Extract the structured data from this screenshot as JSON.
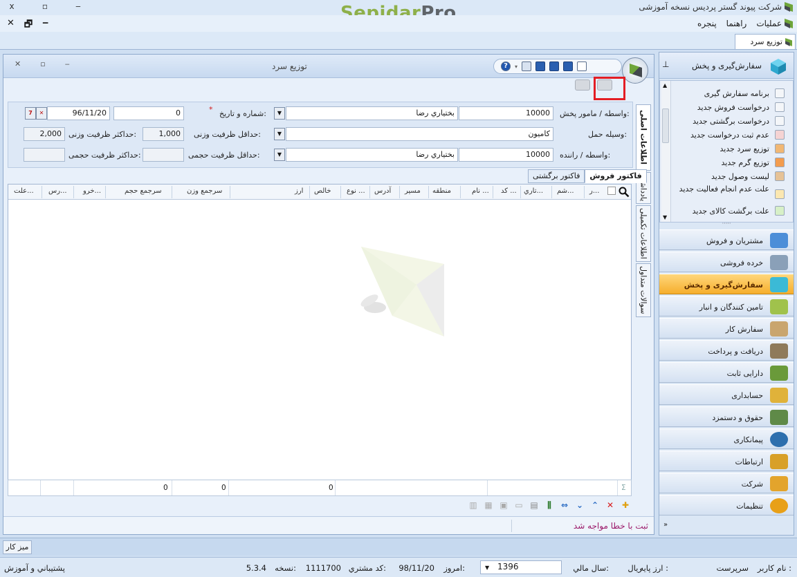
{
  "app": {
    "title": "شرکت پیوند گستر پردیس نسخه آموزشی",
    "brand_part1": "Sepidar",
    "brand_part2": "Pro",
    "window_controls": [
      "x",
      "▫",
      "‒"
    ]
  },
  "menubar": {
    "items": [
      "عملیات",
      "راهنما",
      "پنجره"
    ],
    "mdi_controls": [
      "✕",
      "🗗",
      "‒"
    ]
  },
  "doc_tab": {
    "label": "توزیع سرد"
  },
  "form": {
    "title": "توزیع سرد",
    "window_controls": [
      "✕",
      "▫",
      "‒"
    ],
    "help_label": "?"
  },
  "header": {
    "distributor_label": "واسطه / مامور پخش:",
    "distributor_code": "10000",
    "distributor_name": "بختياري رضا",
    "number_date_label": "شماره و تاریخ:",
    "required_mark": "*",
    "number": "0",
    "date": "96/11/20",
    "vehicle_label": "وسیله حمل:",
    "vehicle": "کامیون",
    "min_weight_label": "حداقل ظرفیت وزنی:",
    "min_weight": "1,000",
    "max_weight_label": "حداکثر ظرفیت وزنی:",
    "max_weight": "2,000",
    "driver_label": "واسطه / راننده:",
    "driver_code": "10000",
    "driver_name": "بختياري رضا",
    "min_volume_label": "حداقل ظرفیت حجمی:",
    "min_volume": "",
    "max_volume_label": "حداکثر ظرفیت حجمی:",
    "max_volume": ""
  },
  "side_tabs": [
    "اطلاعات اصلی",
    "یادداشت",
    "اطلاعات تکمیلی",
    "سوالات متداول"
  ],
  "grid_tabs": [
    "فاکتور فروش",
    "فاکتور برگشتی"
  ],
  "grid": {
    "columns": [
      "ر...",
      "شم...",
      "تاري...",
      "كد ...",
      "نام ...",
      "منطقه",
      "مسير",
      "آدرس",
      "نوع ...",
      "خالص",
      "ارز",
      "سرجمع وزن",
      "سرجمع حجم",
      "خرو...",
      "رس...",
      "علت..."
    ],
    "footer_values": [
      "0",
      "0",
      "0"
    ],
    "sum_symbol": "Σ"
  },
  "status_message": "ثبت با خطا مواجه شد",
  "nav": {
    "header_title": "سفارش‌گیری و پخش",
    "list_items": [
      "برنامه سفارش گیری",
      "درخواست فروش جدید",
      "درخواست برگشتی جدید",
      "عدم ثبت درخواست جدید",
      "توزیع سرد جدید",
      "توزیع گرم جدید",
      "لیست وصول جدید",
      "علت عدم انجام فعالیت جدید",
      "علت برگشت کالای جدید"
    ],
    "modules": [
      {
        "label": "مشتریان و فروش",
        "color": "#4c8ed8"
      },
      {
        "label": "خرده فروشی",
        "color": "#8aa0b8"
      },
      {
        "label": "سفارش‌گیری و پخش",
        "color": "#3bbad6"
      },
      {
        "label": "تامین کنندگان و انبار",
        "color": "#a0c24c"
      },
      {
        "label": "سفارش کار",
        "color": "#c9a56e"
      },
      {
        "label": "دریافت و پرداخت",
        "color": "#8f7a5a"
      },
      {
        "label": "دارایی ثابت",
        "color": "#6a9a3a"
      },
      {
        "label": "حسابداری",
        "color": "#e0b23a"
      },
      {
        "label": "حقوق و دستمزد",
        "color": "#5f8a48"
      },
      {
        "label": "پیمانکاری",
        "color": "#2d6fae"
      },
      {
        "label": "ارتباطات",
        "color": "#d8a028"
      },
      {
        "label": "شرکت",
        "color": "#e3a42c"
      },
      {
        "label": "تنظیمات",
        "color": "#e8a018"
      }
    ],
    "active_module": "سفارش‌گیری و پخش"
  },
  "taskbar": {
    "desk_label": "میز کار"
  },
  "statusbar": {
    "user_label": "نام کاربر :",
    "user": "سرپرست",
    "base_currency_label": "ارز پایه :",
    "base_currency": "ریال",
    "fiscal_year_label": "سال مالي:",
    "fiscal_year": "1396",
    "today_label": "امروز:",
    "today": "98/11/20",
    "customer_code_label": "كد مشتري:",
    "customer_code": "1111700",
    "version_label": "نسخه:",
    "version": "5.3.4",
    "support": "پشتيباني و آموزش"
  }
}
